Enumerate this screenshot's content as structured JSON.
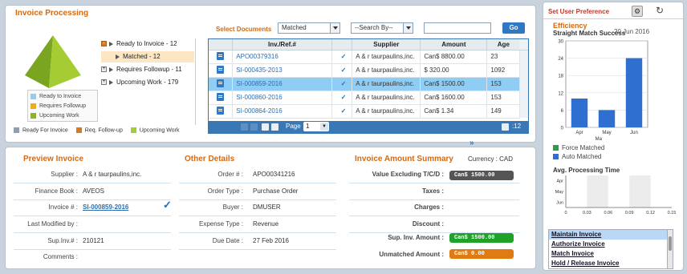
{
  "invoice_processing": {
    "title": "Invoice Processing",
    "tree": [
      {
        "label": "Ready to Invoice - 12",
        "expanded": true
      },
      {
        "label": "Matched - 12",
        "child": true,
        "selected": true
      },
      {
        "label": "Requires Followup - 11"
      },
      {
        "label": "Upcoming Work - 179"
      }
    ],
    "pyramid_legend": [
      "Ready to Invoice",
      "Requires Followup",
      "Upcoming Work"
    ],
    "bottom_legend": [
      "Ready For Invoice",
      "Req. Follow-up",
      "Upcoming Work"
    ],
    "select_documents_label": "Select Documents",
    "select_documents_value": "Matched",
    "search_by_value": "--Search By--",
    "search_value": "",
    "go_label": "Go",
    "columns": [
      "Inv./Ref.#",
      "Supplier",
      "Amount",
      "Age"
    ],
    "rows": [
      {
        "ref": "APO00379316",
        "supplier": "A & r taurpaulins,inc.",
        "amount": "Can$ 8800.00",
        "age": "23"
      },
      {
        "ref": "SI-000435-2013",
        "supplier": "A & r taurpaulins,inc.",
        "amount": "$ 320.00",
        "age": "1092"
      },
      {
        "ref": "SI-000859-2016",
        "supplier": "A & r taurpaulins,inc.",
        "amount": "Can$ 1500.00",
        "age": "153",
        "selected": true
      },
      {
        "ref": "SI-000860-2016",
        "supplier": "A & r taurpaulins,inc.",
        "amount": "Can$ 1600.00",
        "age": "153"
      },
      {
        "ref": "SI-000864-2016",
        "supplier": "A & r taurpaulins,inc.",
        "amount": "Can$ 1.34",
        "age": "149"
      }
    ],
    "pager": {
      "page_label": "Page",
      "page_value": "1",
      "count": ":12"
    }
  },
  "preview": {
    "title": "Preview Invoice",
    "fields": [
      {
        "label": "Supplier :",
        "value": "A & r taurpaulins,inc."
      },
      {
        "label": "Finance Book :",
        "value": "AVEOS"
      },
      {
        "label": "Invoice # :",
        "value": "SI-000859-2016"
      },
      {
        "label": "Last Modified by :",
        "value": ""
      },
      {
        "label": "Sup.Inv.# :",
        "value": "210121"
      },
      {
        "label": "Comments :",
        "value": ""
      }
    ]
  },
  "other_details": {
    "title": "Other Details",
    "fields": [
      {
        "label": "Order # :",
        "value": "APO00341216"
      },
      {
        "label": "Order Type :",
        "value": "Purchase Order"
      },
      {
        "label": "Buyer :",
        "value": "DMUSER"
      },
      {
        "label": "Expense Type :",
        "value": "Revenue"
      },
      {
        "label": "Due Date :",
        "value": "27 Feb 2016"
      }
    ]
  },
  "summary": {
    "title": "Invoice Amount Summary",
    "currency_label": "Currency :",
    "currency_value": "CAD",
    "fields": [
      {
        "label": "Value Excluding T/C/D :",
        "value": "Can$ 1500.00",
        "color": "#555555"
      },
      {
        "label": "Taxes :",
        "value": ""
      },
      {
        "label": "Charges :",
        "value": ""
      },
      {
        "label": "Discount :",
        "value": ""
      },
      {
        "label": "Sup. Inv. Amount :",
        "value": "Can$ 1500.00",
        "color": "#1fa12a"
      },
      {
        "label": "Unmatched Amount :",
        "value": "Can$ 0.00",
        "color": "#e07b12"
      }
    ]
  },
  "right_panel": {
    "set_user_pref": "Set User Preference",
    "efficiency_title": "Efficiency",
    "chart_subtitle": "Straight Match Success",
    "chart_date": "20 Jun 2016",
    "legend": [
      {
        "label": "Force Matched",
        "color": "#2aa040"
      },
      {
        "label": "Auto Matched",
        "color": "#2f6fd0"
      }
    ],
    "avg_title": "Avg. Processing Time",
    "links": [
      "Maintain Invoice",
      "Authorize Invoice",
      "Match Invoice",
      "Hold / Release Invoice"
    ]
  },
  "chart_data": [
    {
      "type": "bar",
      "title": "Straight Match Success",
      "categories": [
        "Apr",
        "May",
        "Jun"
      ],
      "xlabel": "Ma",
      "series": [
        {
          "name": "Auto Matched",
          "values": [
            10,
            6,
            24
          ]
        }
      ],
      "ylim": [
        0,
        30
      ],
      "yticks": [
        0,
        6,
        12,
        18,
        24,
        30
      ]
    },
    {
      "type": "bar",
      "title": "Avg. Processing Time",
      "categories": [
        "Apr",
        "May",
        "Jun"
      ],
      "values": [
        0,
        0,
        0
      ],
      "xticks": [
        "0",
        "0.03",
        "0.06",
        "0.09",
        "0.12",
        "0.15"
      ],
      "xlim": [
        0,
        0.15
      ]
    }
  ],
  "colors": {
    "accent": "#d26a13",
    "grid_border": "#3a77b5",
    "selected_row": "#8fcdf5"
  }
}
